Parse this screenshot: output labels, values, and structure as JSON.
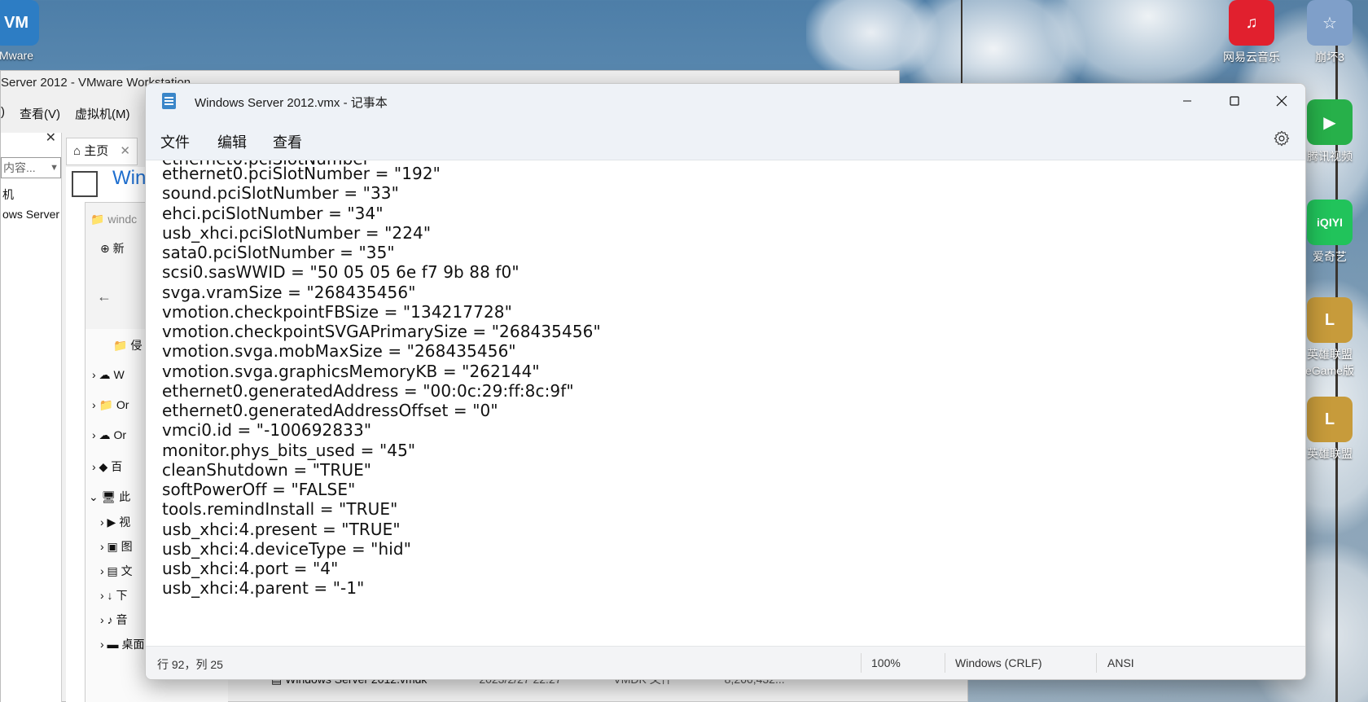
{
  "desktop": {
    "icons": [
      {
        "label": "Mware",
        "color": "#2d7dc4",
        "glyph": "VM"
      },
      {
        "label": "网易云音乐",
        "color": "#e1202e",
        "glyph": "♫"
      },
      {
        "label": "崩坏3",
        "color": "#7f9fc9",
        "glyph": "☆"
      },
      {
        "label": "腾讯视频",
        "color": "#27b04a",
        "glyph": "▶"
      },
      {
        "label": "爱奇艺",
        "color": "#21c35b",
        "glyph": "iQIYI"
      },
      {
        "label": "英雄联盟",
        "sub": "eGame版",
        "color": "#c79b3b",
        "glyph": "L"
      },
      {
        "label": "英雄联盟",
        "color": "#c79b3b",
        "glyph": "L"
      }
    ]
  },
  "vmware": {
    "title": "Server 2012 - VMware Workstation",
    "menu": [
      ")",
      "查看(V)",
      "虚拟机(M)"
    ],
    "search_placeholder": "内容...",
    "tree": [
      "机",
      "ows Server"
    ],
    "tabs": [
      "主页"
    ],
    "big_title": "Win",
    "bg_file": {
      "name": "Windows Server 2012.vmdk",
      "date": "2023/2/27 22:27",
      "type": "VMDK 文件",
      "size": "8,266,432..."
    }
  },
  "explorer": {
    "address": "windc",
    "new_label": "新",
    "nav_items": [
      "W",
      "Or",
      "Or",
      "百",
      "此",
      "视",
      "图",
      "文",
      "下",
      "音",
      "桌面"
    ],
    "folder_label": "侵"
  },
  "notepad": {
    "title": "Windows Server 2012.vmx - 记事本",
    "menu": {
      "file": "文件",
      "edit": "编辑",
      "view": "查看"
    },
    "lines": [
      "ethernet0.pciSlotNumber = \"192\"",
      "sound.pciSlotNumber = \"33\"",
      "ehci.pciSlotNumber = \"34\"",
      "usb_xhci.pciSlotNumber = \"224\"",
      "sata0.pciSlotNumber = \"35\"",
      "scsi0.sasWWID = \"50 05 05 6e f7 9b 88 f0\"",
      "svga.vramSize = \"268435456\"",
      "vmotion.checkpointFBSize = \"134217728\"",
      "vmotion.checkpointSVGAPrimarySize = \"268435456\"",
      "vmotion.svga.mobMaxSize = \"268435456\"",
      "vmotion.svga.graphicsMemoryKB = \"262144\"",
      "ethernet0.generatedAddress = \"00:0c:29:ff:8c:9f\"",
      "ethernet0.generatedAddressOffset = \"0\"",
      "vmci0.id = \"-100692833\"",
      "monitor.phys_bits_used = \"45\"",
      "cleanShutdown = \"TRUE\"",
      "softPowerOff = \"FALSE\"",
      "tools.remindInstall = \"TRUE\"",
      "usb_xhci:4.present = \"TRUE\"",
      "usb_xhci:4.deviceType = \"hid\"",
      "usb_xhci:4.port = \"4\"",
      "usb_xhci:4.parent = \"-1\""
    ],
    "status": {
      "position": "行 92，列 25",
      "zoom": "100%",
      "line_ending": "Windows (CRLF)",
      "encoding": "ANSI"
    }
  }
}
